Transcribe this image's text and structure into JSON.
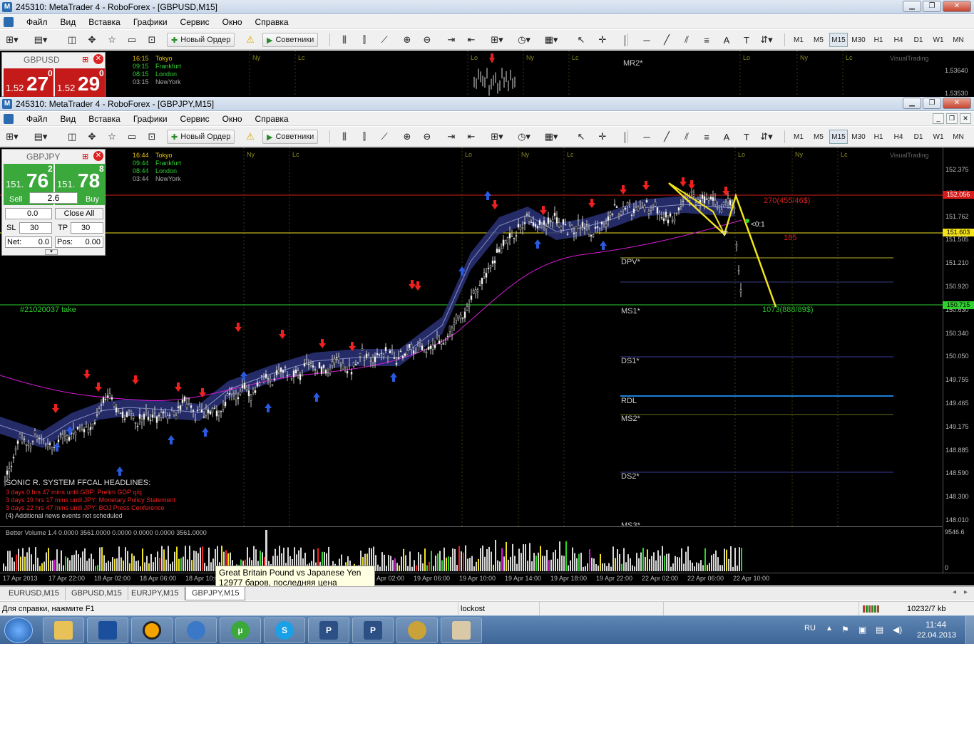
{
  "window1": {
    "title": "245310: MetaTrader 4 - RoboForex - [GBPUSD,M15]",
    "symbol": "GBPUSD",
    "bid_small": "1.52",
    "bid_big": "27",
    "bid_sup": "0",
    "ask_small": "1.52",
    "ask_big": "29",
    "ask_sup": "0",
    "sessions": [
      {
        "time": "16:15",
        "name": "Tokyo"
      },
      {
        "time": "09:15",
        "name": "Frankfurt"
      },
      {
        "time": "08:15",
        "name": "London"
      },
      {
        "time": "03:15",
        "name": "NewYork"
      }
    ],
    "level_label": "MR2*",
    "prices": [
      "1.53640",
      "1.53530"
    ],
    "session_marks": [
      "Ny",
      "Lc",
      "Lo",
      "Ny",
      "Lc",
      "Lo",
      "Ny",
      "Lc"
    ],
    "brand": "VisualTrading"
  },
  "window2": {
    "title": "245310: MetaTrader 4 - RoboForex - [GBPJPY,M15]"
  },
  "menu": [
    "Файл",
    "Вид",
    "Вставка",
    "Графики",
    "Сервис",
    "Окно",
    "Справка"
  ],
  "toolbar": {
    "new_order": "Новый Ордер",
    "advisors": "Советники",
    "timeframes": [
      "M1",
      "M5",
      "M15",
      "M30",
      "H1",
      "H4",
      "D1",
      "W1",
      "MN"
    ],
    "active_tf": "M15"
  },
  "trade_panel": {
    "symbol": "GBPJPY",
    "sell_small": "151.",
    "sell_big": "76",
    "sell_sup": "2",
    "buy_small": "151.",
    "buy_big": "78",
    "buy_sup": "8",
    "sell_label": "Sell",
    "buy_label": "Buy",
    "spread": "2.6",
    "lot": "0.0",
    "close_all": "Close All",
    "sl_label": "SL",
    "sl_value": "30",
    "tp_label": "TP",
    "tp_value": "30",
    "net_label": "Net:",
    "net_value": "0.0",
    "pos_label": "Pos:",
    "pos_value": "0.00"
  },
  "chart": {
    "sessions": [
      {
        "time": "16:44",
        "name": "Tokyo"
      },
      {
        "time": "09:44",
        "name": "Frankfurt"
      },
      {
        "time": "08:44",
        "name": "London"
      },
      {
        "time": "03:44",
        "name": "NewYork"
      }
    ],
    "session_marks": [
      "Ny",
      "Lc",
      "Lo",
      "Ny",
      "Lc",
      "Lo",
      "Ny",
      "Lc"
    ],
    "brand": "VisualTrading",
    "price_axis": [
      "152.375",
      "152.040",
      "151.762",
      "151.505",
      "151.210",
      "150.920",
      "150.630",
      "150.340",
      "150.050",
      "149.755",
      "149.465",
      "149.175",
      "148.885",
      "148.590",
      "148.300",
      "148.010"
    ],
    "red_price": "152.056",
    "yellow_price": "151.603",
    "green_price": "150.715",
    "take_label": "#21020037  take",
    "levels": [
      "DPV*",
      "MS1*",
      "DS1*",
      "RDL",
      "MS2*",
      "DS2*",
      "MS3*"
    ],
    "pattern_label_1": "270(455/46$)",
    "pattern_label_2": "185",
    "pattern_label_3": "1073(888/89$)",
    "ratio_label": "<0:1",
    "headline_title": "SONIC R. SYSTEM  FFCAL HEADLINES:",
    "headlines": [
      "3 days 0 hrs 47 mins until GBP: Prelim GDP q/q",
      "3 days 19 hrs 17 mins until JPY: Monetary Policy Statement",
      "3 days 22 hrs 47 mins until JPY: BOJ Press Conference",
      "(4)  Additional news events not scheduled"
    ],
    "volume_title": "Better Volume 1.4 0.0000 3561.0000 0.0000 0.0000 0.0000 3561.0000",
    "volume_axis": [
      "9546.6",
      "0"
    ],
    "time_axis": [
      "17 Apr 2013",
      "17 Apr 22:00",
      "18 Apr 02:00",
      "18 Apr 06:00",
      "18 Apr 10:00",
      "19 Apr 02:00",
      "19 Apr 06:00",
      "19 Apr 10:00",
      "19 Apr 14:00",
      "19 Apr 18:00",
      "19 Apr 22:00",
      "22 Apr 02:00",
      "22 Apr 06:00",
      "22 Apr 10:00"
    ]
  },
  "tooltip": {
    "line1": "Great Britain Pound vs Japanese Yen",
    "line2": "12977 баров, последняя цена 151.75800"
  },
  "tabs": [
    "EURUSD,M15",
    "GBPUSD,M15",
    "EURJPY,M15",
    "GBPJPY,M15"
  ],
  "active_tab": "GBPJPY,M15",
  "status": {
    "help": "Для справки, нажмите F1",
    "profile": "lockost",
    "traffic": "10232/7 kb"
  },
  "taskbar": {
    "lang": "RU",
    "time": "11:44",
    "date": "22.04.2013"
  }
}
